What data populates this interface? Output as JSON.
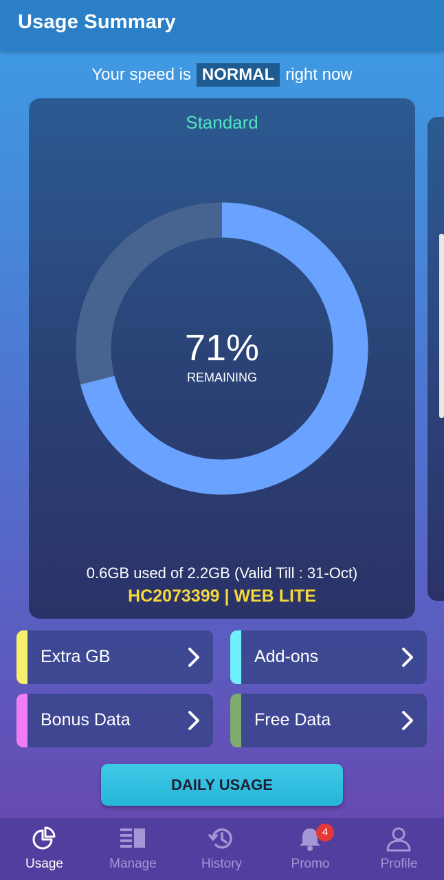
{
  "app_bar": {
    "title": "Usage Summary"
  },
  "speed": {
    "prefix": "Your speed is",
    "status": "NORMAL",
    "suffix": "right now"
  },
  "plan_card": {
    "plan_name": "Standard",
    "remaining_percent_label": "71%",
    "remaining_label": "REMAINING",
    "remaining_fraction": 0.71,
    "usage_text": "0.6GB used of 2.2GB (Valid Till : 31-Oct)",
    "account_text": "HC2073399 | WEB LITE",
    "colors": {
      "remaining": "#6aa3ff",
      "used": "#47638f",
      "plan_name": "#4fe3c3",
      "account": "#f4d93b"
    }
  },
  "tiles": [
    {
      "label": "Extra GB",
      "color": "#f6ef6b",
      "icon": "chevron-right-icon"
    },
    {
      "label": "Add-ons",
      "color": "#6ff1f9",
      "icon": "chevron-right-icon"
    },
    {
      "label": "Bonus Data",
      "color": "#f07ef2",
      "icon": "chevron-right-icon"
    },
    {
      "label": "Free Data",
      "color": "#7eab6e",
      "icon": "chevron-right-icon"
    }
  ],
  "daily_usage": {
    "label": "DAILY USAGE"
  },
  "nav": {
    "items": [
      {
        "label": "Usage",
        "icon": "pie-chart-icon",
        "active": true
      },
      {
        "label": "Manage",
        "icon": "manage-icon",
        "active": false
      },
      {
        "label": "History",
        "icon": "history-icon",
        "active": false
      },
      {
        "label": "Promo",
        "icon": "bell-icon",
        "active": false,
        "badge": "4"
      },
      {
        "label": "Profile",
        "icon": "profile-icon",
        "active": false
      }
    ]
  }
}
